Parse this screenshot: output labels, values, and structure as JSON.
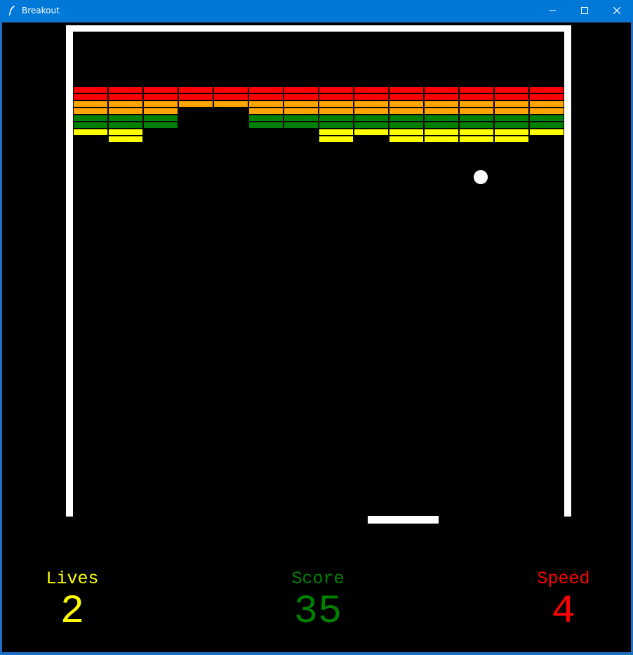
{
  "window": {
    "title": "Breakout",
    "app_icon": "feather-icon",
    "buttons": [
      "minimize-icon",
      "maximize-icon",
      "close-icon"
    ]
  },
  "colors": {
    "background": "#000000",
    "wall": "#ffffff",
    "red": "#ff0000",
    "orange": "#ffa500",
    "green": "#008000",
    "yellow": "#ffff00"
  },
  "bricks": {
    "columns": 14,
    "rows": [
      {
        "color": "red",
        "present": [
          1,
          1,
          1,
          1,
          1,
          1,
          1,
          1,
          1,
          1,
          1,
          1,
          1,
          1
        ]
      },
      {
        "color": "red",
        "present": [
          1,
          1,
          1,
          1,
          1,
          1,
          1,
          1,
          1,
          1,
          1,
          1,
          1,
          1
        ]
      },
      {
        "color": "orange",
        "present": [
          1,
          1,
          1,
          1,
          1,
          1,
          1,
          1,
          1,
          1,
          1,
          1,
          1,
          1
        ]
      },
      {
        "color": "orange",
        "present": [
          1,
          1,
          1,
          0,
          0,
          1,
          1,
          1,
          1,
          1,
          1,
          1,
          1,
          1
        ]
      },
      {
        "color": "green",
        "present": [
          1,
          1,
          1,
          0,
          0,
          1,
          1,
          1,
          1,
          1,
          1,
          1,
          1,
          1
        ]
      },
      {
        "color": "green",
        "present": [
          1,
          1,
          1,
          0,
          0,
          1,
          1,
          1,
          1,
          1,
          1,
          1,
          1,
          1
        ]
      },
      {
        "color": "yellow",
        "present": [
          1,
          1,
          0,
          0,
          0,
          0,
          0,
          1,
          1,
          1,
          1,
          1,
          1,
          1
        ]
      },
      {
        "color": "yellow",
        "present": [
          0,
          1,
          0,
          0,
          0,
          0,
          0,
          1,
          0,
          1,
          1,
          1,
          1,
          0
        ]
      }
    ]
  },
  "hud": {
    "lives": {
      "label": "Lives",
      "value": "2",
      "color": "#ffff00"
    },
    "score": {
      "label": "Score",
      "value": "35",
      "color": "#008000"
    },
    "speed": {
      "label": "Speed",
      "value": "4",
      "color": "#ff0000"
    }
  }
}
